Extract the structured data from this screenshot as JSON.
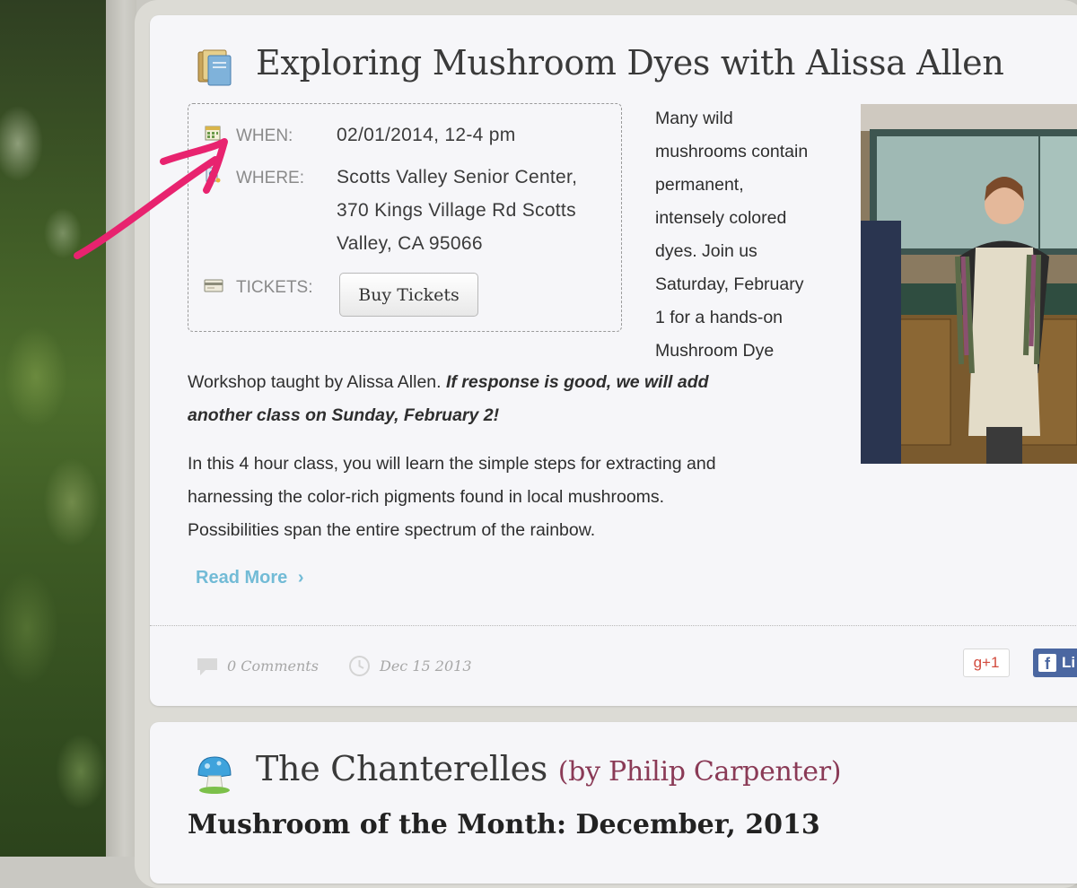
{
  "post": {
    "title": "Exploring Mushroom Dyes with Alissa Allen",
    "when_label": "WHEN:",
    "when_value": "02/01/2014, 12-4 pm",
    "where_label": "WHERE:",
    "where_lines": [
      "Scotts Valley Senior Center,",
      "370 Kings Village Rd Scotts",
      "Valley, CA 95066"
    ],
    "tickets_label": "TICKETS:",
    "buy_button": "Buy Tickets",
    "right_lines": [
      "Many wild",
      "mushrooms contain",
      "permanent,",
      "intensely colored",
      "dyes. Join us",
      "Saturday, February",
      "1 for a hands-on",
      "Mushroom Dye"
    ],
    "para1_plain": "Workshop taught by Alissa Allen. ",
    "para1_bold_line1": "If response is good, we will add",
    "para1_bold_line2": "another class on Sunday, February 2!",
    "para2_lines": [
      "In this 4 hour class, you will learn the simple steps for extracting and",
      "harnessing the color-rich pigments found in local mushrooms.",
      "Possibilities span the entire spectrum of the rainbow."
    ],
    "read_more": "Read More",
    "read_more_chevron": "›",
    "comments": "0 Comments",
    "date": "Dec 15 2013",
    "gplus": "g+1",
    "fb_f": "f",
    "fb_like": "Li"
  },
  "post2": {
    "title": "The Chanterelles",
    "byline": "(by Philip Carpenter)",
    "subtitle": "Mushroom of the Month: December, 2013"
  },
  "colors": {
    "accent_link": "#72bbd6",
    "annotation_arrow": "#e8236f",
    "byline": "#8a3a56"
  },
  "icons": [
    "book-icon",
    "calendar-icon",
    "location-icon",
    "ticket-icon",
    "comment-icon",
    "clock-icon",
    "mushroom-icon"
  ]
}
